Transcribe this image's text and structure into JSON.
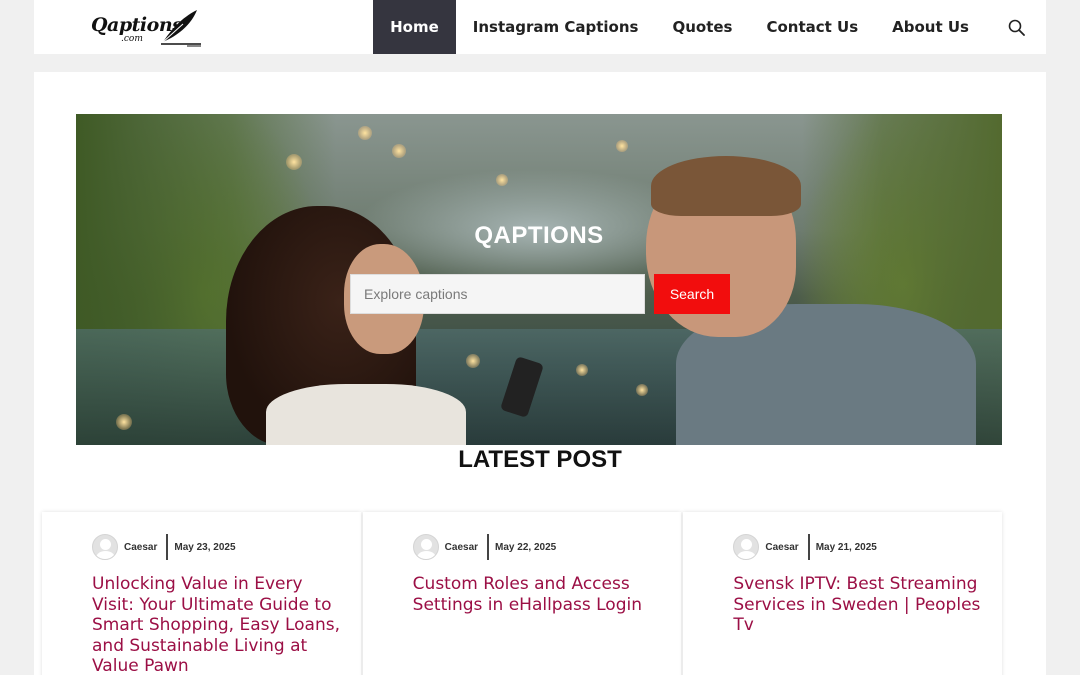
{
  "header": {
    "logo_text": "Qaptions",
    "logo_sub": ".com",
    "nav": [
      {
        "label": "Home",
        "active": true
      },
      {
        "label": "Instagram Captions",
        "active": false
      },
      {
        "label": "Quotes",
        "active": false
      },
      {
        "label": "Contact Us",
        "active": false
      },
      {
        "label": "About Us",
        "active": false
      }
    ],
    "search_icon": "search-icon"
  },
  "hero": {
    "title": "QAPTIONS",
    "search_placeholder": "Explore captions",
    "search_button": "Search"
  },
  "latest": {
    "title": "LATEST POST",
    "posts": [
      {
        "author": "Caesar",
        "date": "May 23, 2025",
        "title": "Unlocking Value in Every Visit: Your Ultimate Guide to Smart Shopping, Easy Loans, and Sustainable Living at Value Pawn"
      },
      {
        "author": "Caesar",
        "date": "May 22, 2025",
        "title": "Custom Roles and Access Settings in eHallpass Login"
      },
      {
        "author": "Caesar",
        "date": "May 21, 2025",
        "title": "Svensk IPTV: Best Streaming Services in Sweden | Peoples Tv"
      }
    ]
  },
  "colors": {
    "nav_active_bg": "#35353f",
    "search_button_bg": "#f20d0d",
    "post_title": "#9b0f45"
  }
}
